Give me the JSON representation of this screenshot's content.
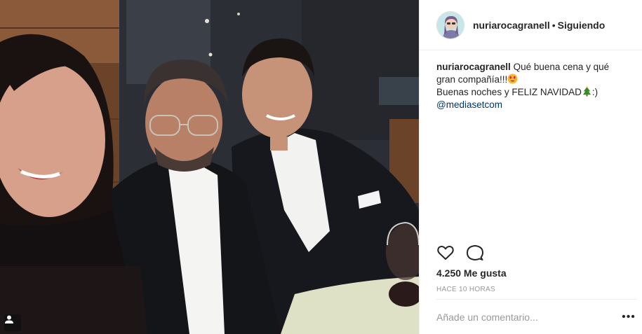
{
  "post": {
    "username": "nuriarocagranell",
    "separator": "•",
    "follow_status": "Siguiendo",
    "caption": {
      "username": "nuriarocagranell",
      "line1": "Qué buena cena y qué gran compañía!!!",
      "line2": "Buenas noches y FELIZ NAVIDAD",
      "line2_end": ":)",
      "mention": "@mediasetcom"
    },
    "likes": "4.250 Me gusta",
    "time": "HACE 10 HORAS",
    "comment_placeholder": "Añade un comentario...",
    "more_label": "•••"
  },
  "icons": {
    "like": "heart-outline-icon",
    "comment": "speech-bubble-icon",
    "photo_badge": "user-tag-icon",
    "emoji_1": "heart-eyes-emoji",
    "emoji_2": "christmas-tree-emoji"
  },
  "colors": {
    "text": "#262626",
    "muted": "#999999",
    "mention": "#003569",
    "border": "#efefef"
  }
}
